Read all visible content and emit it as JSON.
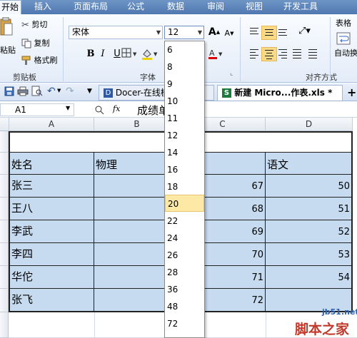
{
  "ribbon_tabs": [
    "开始",
    "插入",
    "页面布局",
    "公式",
    "数据",
    "审阅",
    "视图",
    "开发工具"
  ],
  "clipboard": {
    "paste": "粘贴",
    "cut": "剪切",
    "copy": "复制",
    "format_painter": "格式刷",
    "group_label": "剪贴板"
  },
  "font": {
    "name": "宋体",
    "size": "12",
    "bold": "B",
    "italic": "I",
    "underline": "U",
    "grow": "A",
    "shrink": "A",
    "group_label": "字体"
  },
  "align": {
    "group_label": "对齐方式",
    "wrap": "自动换"
  },
  "right_partial": "表格",
  "doc_tabs": [
    {
      "label": "Docer-在线模"
    },
    {
      "label": "新建 Micro...作表.xls *"
    }
  ],
  "add_tab": "+",
  "formula_bar": {
    "cell_ref": "A1",
    "fx": "fx",
    "content": "成绩单"
  },
  "columns": [
    "A",
    "B",
    "C",
    "D"
  ],
  "table": {
    "headers": [
      "姓名",
      "物理",
      "",
      "语文"
    ],
    "rows": [
      {
        "name": "张三",
        "c": "67",
        "d": "50"
      },
      {
        "name": "王八",
        "c": "68",
        "d": "51"
      },
      {
        "name": "李武",
        "c": "69",
        "d": "52"
      },
      {
        "name": "李四",
        "c": "70",
        "d": "53"
      },
      {
        "name": "华佗",
        "c": "71",
        "d": "54"
      },
      {
        "name": "张飞",
        "c": "72",
        "d": ""
      }
    ]
  },
  "font_size_options": [
    "6",
    "8",
    "9",
    "10",
    "11",
    "12",
    "14",
    "16",
    "18",
    "20",
    "22",
    "24",
    "26",
    "28",
    "36",
    "48",
    "72"
  ],
  "font_size_highlighted": "20",
  "watermark": {
    "url": "jb51.net",
    "site": "脚本之家"
  }
}
